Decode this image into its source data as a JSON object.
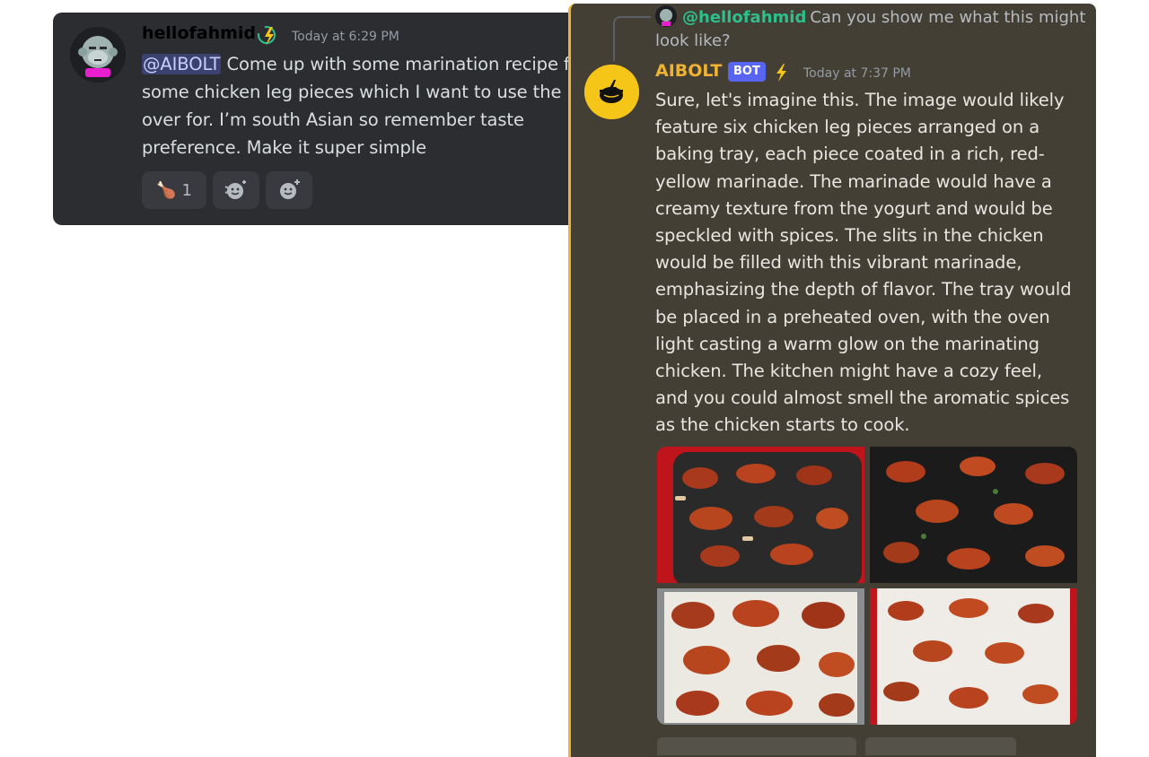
{
  "left_message": {
    "username": "hellofahmid",
    "username_color": "#2dc08d",
    "badge_icon": "lightning-badge-icon",
    "timestamp": "Today at 6:29 PM",
    "mention": "@AIBOLT",
    "text": " Come up with some marination recipe for some chicken leg pieces which I want to use the over for. I’m south Asian so remember taste preference. Make it super simple",
    "reactions": [
      {
        "emoji": "🍗",
        "count": "1",
        "icon": "poultry-leg-emoji"
      },
      {
        "icon": "add-super-reaction-icon"
      },
      {
        "icon": "add-reaction-icon"
      }
    ]
  },
  "right_message": {
    "reply": {
      "username": "@hellofahmid",
      "text": "Can you show me what this might look like?"
    },
    "username": "AIBOLT",
    "username_color": "#f0b232",
    "bot_tag": "BOT",
    "badge_icon": "lightning-icon",
    "timestamp": "Today at 7:37 PM",
    "text": "Sure, let's imagine this. The image would likely feature six chicken leg pieces arranged on a baking tray, each piece coated in a rich, red-yellow marinade. The marinade would have a creamy texture from the yogurt and would be speckled with spices. The slits in the chicken would be filled with this vibrant marinade, emphasizing the depth of flavor. The tray would be placed in a preheated oven, with the oven light casting a warm glow on the marinating chicken. The kitchen might have a cozy feel, and you could almost smell the aromatic spices as the chicken starts to cook.",
    "images": [
      "chicken-image-1",
      "chicken-image-2",
      "chicken-image-3",
      "chicken-image-4"
    ]
  },
  "colors": {
    "accent": "#f0b232",
    "mention_bg": "#3c4270",
    "bot_tag": "#5865f2"
  }
}
